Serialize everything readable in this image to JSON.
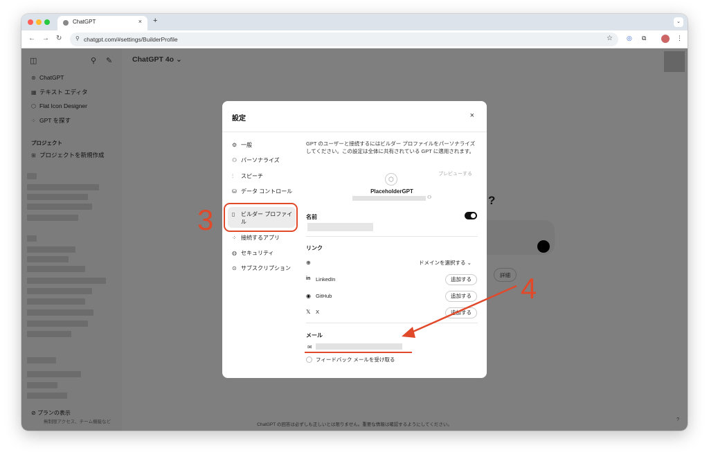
{
  "browser": {
    "tab_title": "ChatGPT",
    "tab_close": "×",
    "new_tab": "+",
    "tab_menu": "⌄",
    "url": "chatgpt.com/#settings/BuilderProfile",
    "back": "←",
    "forward": "→",
    "reload": "↻",
    "star": "☆",
    "ext1": "◎",
    "ext2": "⧉",
    "menu": "⋮"
  },
  "sidebar": {
    "items": [
      {
        "icon": "⊛",
        "label": "ChatGPT"
      },
      {
        "icon": "▦",
        "label": "テキスト エディタ"
      },
      {
        "icon": "⬡",
        "label": "Flat Icon Designer"
      },
      {
        "icon": "⁘",
        "label": "GPT を探す"
      }
    ],
    "projects_heading": "プロジェクト",
    "new_project": {
      "icon": "⊞",
      "label": "プロジェクトを新規作成"
    },
    "plan_label": "プランの表示",
    "plan_sub": "無制限アクセス、チーム機能など"
  },
  "main": {
    "model_name": "ChatGPT 4o ⌄",
    "question_mark": "?",
    "pill_detail": "詳細",
    "footer_note": "ChatGPT の回答は必ずしも正しいとは限りません。重要な情報は確認するようにしてください。",
    "help": "?"
  },
  "modal": {
    "title": "設定",
    "close": "×",
    "nav": [
      {
        "icon": "⚙",
        "label": "一般"
      },
      {
        "icon": "⚇",
        "label": "パーソナライズ"
      },
      {
        "icon": "⫶",
        "label": "スピーチ"
      },
      {
        "icon": "⛁",
        "label": "データ コントロール"
      },
      {
        "icon": "▯",
        "label": "ビルダー プロファイル"
      },
      {
        "icon": "⁘",
        "label": "接続するアプリ"
      },
      {
        "icon": "◍",
        "label": "セキュリティ"
      },
      {
        "icon": "⊙",
        "label": "サブスクリプション"
      }
    ],
    "description": "GPT のユーザーと接続するにはビルダー プロファイルをパーソナライズしてください。この設定は全体に共有されている GPT に適用されます。",
    "preview": "プレビューする",
    "gpt_icon": "⬡",
    "gpt_name": "PlaceholderGPT",
    "name_label": "名前",
    "links_label": "リンク",
    "domain_select": "ドメインを選択する ⌄",
    "links": [
      {
        "icon": "in",
        "label": "LinkedIn",
        "button": "追加する"
      },
      {
        "icon": "◉",
        "label": "GitHub",
        "button": "追加する"
      },
      {
        "icon": "𝕏",
        "label": "X",
        "button": "追加する"
      }
    ],
    "email_label": "メール",
    "feedback_label": "フィードバック メールを受け取る"
  },
  "annotations": {
    "step3": "3",
    "step4": "4"
  },
  "colors": {
    "annotation": "#e0492a"
  }
}
